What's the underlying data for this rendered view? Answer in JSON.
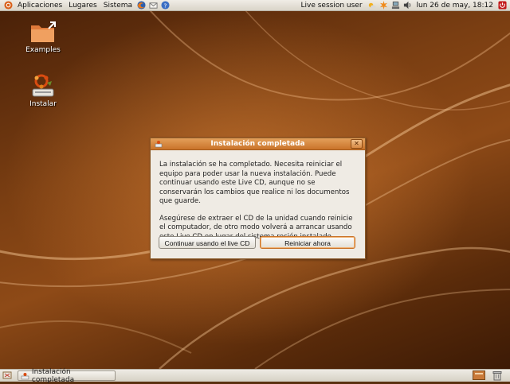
{
  "top_panel": {
    "menus": [
      "Aplicaciones",
      "Lugares",
      "Sistema"
    ],
    "user": "Live session user",
    "clock": "lun 26 de may, 18:12"
  },
  "desktop": {
    "icons": [
      {
        "label": "Examples",
        "icon": "folder-icon"
      },
      {
        "label": "Instalar",
        "icon": "installer-icon"
      }
    ]
  },
  "dialog": {
    "title": "Instalación completada",
    "message1": "La instalación se ha completado. Necesita reiniciar el equipo para poder usar la nueva instalación. Puede continuar usando este Live CD, aunque no se conservarán los cambios que realice ni los documentos que guarde.",
    "message2": "Asegúrese de extraer el CD de la unidad cuando reinicie el computador, de otro modo volverá a arrancar usando este Live CD en lugar del sistema recién instalado.",
    "continue_label": "Continuar usando el live CD",
    "restart_label": "Reiniciar ahora",
    "close_glyph": "✕"
  },
  "bottom_panel": {
    "task_label": "Instalación completada"
  },
  "colors": {
    "accent": "#c9732a",
    "wallpaper": "#7a3e12"
  }
}
